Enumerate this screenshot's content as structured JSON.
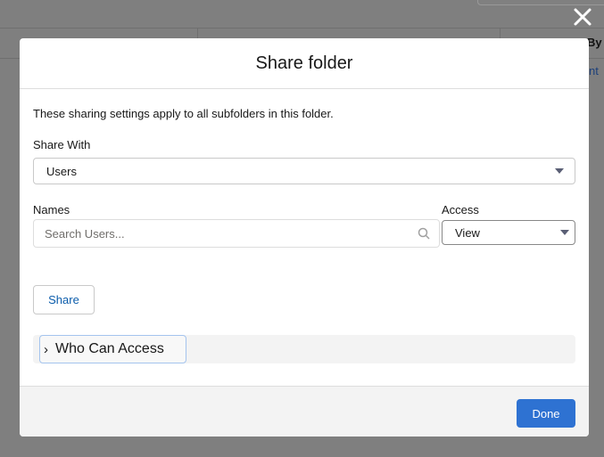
{
  "background": {
    "col_header_partial": "By",
    "link_partial": "nt"
  },
  "modal": {
    "title": "Share folder",
    "note": "These sharing settings apply to all subfolders in this folder.",
    "share_with": {
      "label": "Share With",
      "value": "Users"
    },
    "names": {
      "label": "Names",
      "placeholder": "Search Users..."
    },
    "access": {
      "label": "Access",
      "value": "View"
    },
    "share_button": "Share",
    "who_can_access": "Who Can Access",
    "done_button": "Done"
  },
  "colors": {
    "brand": "#2e72d2",
    "overlay": "#7f7f7f"
  }
}
